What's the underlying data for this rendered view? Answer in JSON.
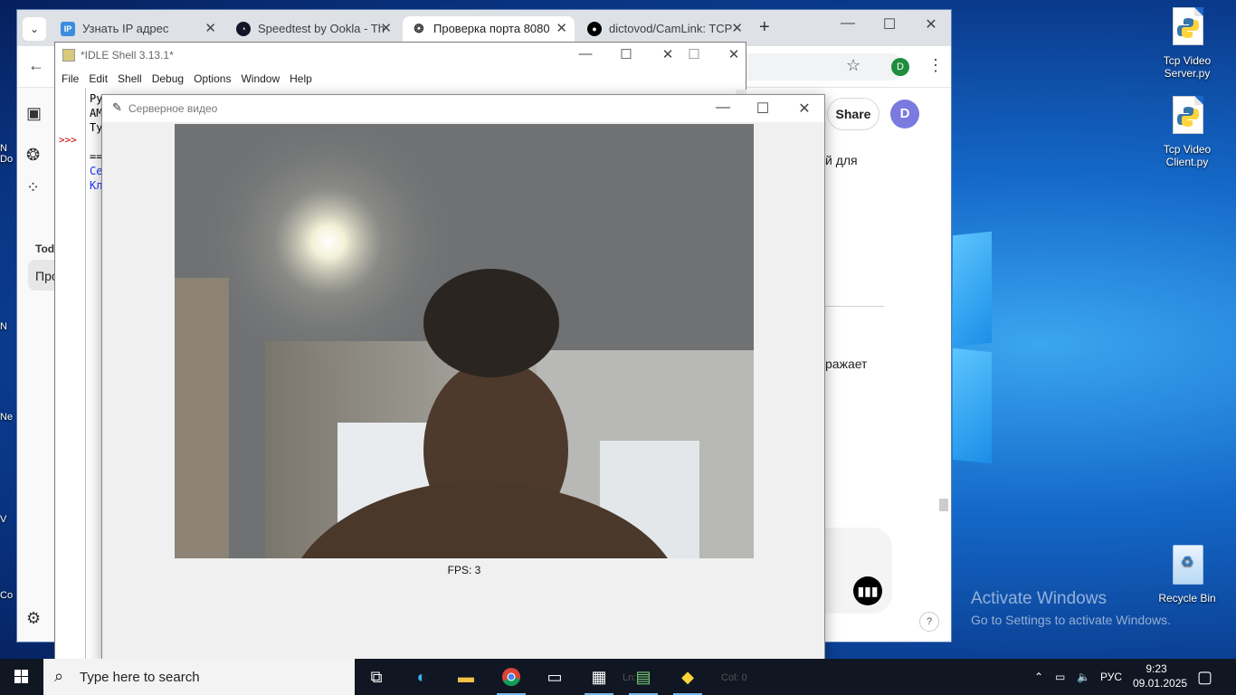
{
  "browser": {
    "tabs": [
      {
        "label": "Узнать IP адрес",
        "favicon": "IP"
      },
      {
        "label": "Speedtest by Ookla - Th",
        "favicon": "speedtest-icon"
      },
      {
        "label": "Проверка порта 8080",
        "favicon": "chatgpt-icon"
      },
      {
        "label": "dictovod/CamLink: TCP",
        "favicon": "github-icon"
      }
    ],
    "profile_initial": "D",
    "share_label": "Share",
    "account_initial": "D",
    "sidebar_today": "Toda",
    "sidebar_history_item": "Про",
    "chat_fragment_1": "й для",
    "chat_fragment_2": "ражает",
    "help_label": "?"
  },
  "idle": {
    "title": "*IDLE Shell 3.13.1*",
    "menu": [
      "File",
      "Edit",
      "Shell",
      "Debug",
      "Options",
      "Window",
      "Help"
    ],
    "prompt": ">>>",
    "lines": [
      "Pyt",
      "AM",
      "Ty",
      "",
      "==",
      "Се",
      "Кл"
    ],
    "status_ln": "Ln:",
    "status_col": "Col: 0"
  },
  "video_window": {
    "title": "Серверное видео",
    "fps_label": "FPS: 3"
  },
  "desktop": {
    "icons": [
      {
        "label": "Tcp Video Server.py"
      },
      {
        "label": "Tcp Video Client.py"
      },
      {
        "label": "Recycle Bin"
      }
    ],
    "activate_title": "Activate Windows",
    "activate_sub": "Go to Settings to activate Windows.",
    "left_fragments": [
      "N Do",
      "",
      "N",
      "Ne",
      "",
      "V",
      "Co"
    ]
  },
  "taskbar": {
    "search_placeholder": "Type here to search",
    "language": "РУС",
    "time": "9:23",
    "date": "09.01.2025"
  },
  "colors": {
    "accent": "#1577d6",
    "taskbar": "#101722",
    "idle_prompt": "#c00000",
    "idle_output": "#1f32ff"
  }
}
